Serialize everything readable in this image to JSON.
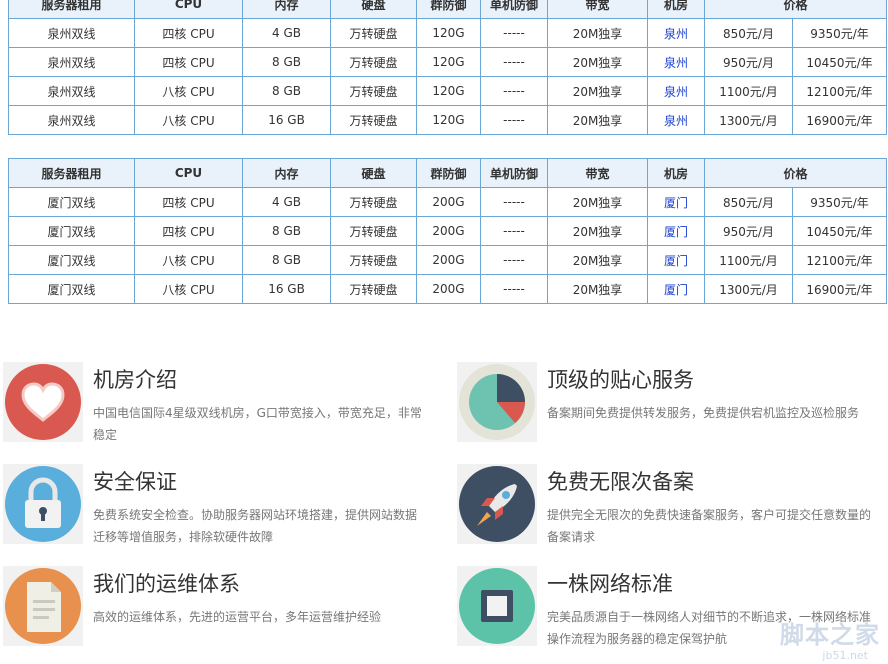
{
  "tables": [
    {
      "headers": [
        "服务器租用",
        "CPU",
        "内存",
        "硬盘",
        "群防御",
        "单机防御",
        "带宽",
        "机房",
        "价格"
      ],
      "rows": [
        [
          "泉州双线",
          "四核 CPU",
          "4 GB",
          "万转硬盘",
          "120G",
          "-----",
          "20M独享",
          "泉州",
          "850元/月",
          "9350元/年"
        ],
        [
          "泉州双线",
          "四核 CPU",
          "8 GB",
          "万转硬盘",
          "120G",
          "-----",
          "20M独享",
          "泉州",
          "950元/月",
          "10450元/年"
        ],
        [
          "泉州双线",
          "八核 CPU",
          "8 GB",
          "万转硬盘",
          "120G",
          "-----",
          "20M独享",
          "泉州",
          "1100元/月",
          "12100元/年"
        ],
        [
          "泉州双线",
          "八核 CPU",
          "16 GB",
          "万转硬盘",
          "120G",
          "-----",
          "20M独享",
          "泉州",
          "1300元/月",
          "16900元/年"
        ]
      ]
    },
    {
      "headers": [
        "服务器租用",
        "CPU",
        "内存",
        "硬盘",
        "群防御",
        "单机防御",
        "带宽",
        "机房",
        "价格"
      ],
      "rows": [
        [
          "厦门双线",
          "四核 CPU",
          "4 GB",
          "万转硬盘",
          "200G",
          "-----",
          "20M独享",
          "厦门",
          "850元/月",
          "9350元/年"
        ],
        [
          "厦门双线",
          "四核 CPU",
          "8 GB",
          "万转硬盘",
          "200G",
          "-----",
          "20M独享",
          "厦门",
          "950元/月",
          "10450元/年"
        ],
        [
          "厦门双线",
          "八核 CPU",
          "8 GB",
          "万转硬盘",
          "200G",
          "-----",
          "20M独享",
          "厦门",
          "1100元/月",
          "12100元/年"
        ],
        [
          "厦门双线",
          "八核 CPU",
          "16 GB",
          "万转硬盘",
          "200G",
          "-----",
          "20M独享",
          "厦门",
          "1300元/月",
          "16900元/年"
        ]
      ]
    }
  ],
  "features": [
    {
      "icon": "heart-icon",
      "title": "机房介绍",
      "desc": "中国电信国际4星级双线机房，G口带宽接入，带宽充足，非常稳定"
    },
    {
      "icon": "pie-chart-icon",
      "title": "顶级的贴心服务",
      "desc": "备案期间免费提供转发服务，免费提供宕机监控及巡检服务"
    },
    {
      "icon": "lock-icon",
      "title": "安全保证",
      "desc": "免费系统安全检查。协助服务器网站环境搭建，提供网站数据迁移等增值服务，排除软硬件故障"
    },
    {
      "icon": "rocket-icon",
      "title": "免费无限次备案",
      "desc": "提供完全无限次的免费快速备案服务，客户可提交任意数量的备案请求"
    },
    {
      "icon": "document-icon",
      "title": "我们的运维体系",
      "desc": "高效的运维体系，先进的运营平台，多年运营维护经验"
    },
    {
      "icon": "square-icon",
      "title": "一株网络标准",
      "desc": "完美品质源自于一株网络人对细节的不断追求，一株网络标准操作流程为服务器的稳定保驾护航"
    }
  ],
  "watermark": {
    "text": "脚本之家",
    "sub": "jb51.net"
  }
}
